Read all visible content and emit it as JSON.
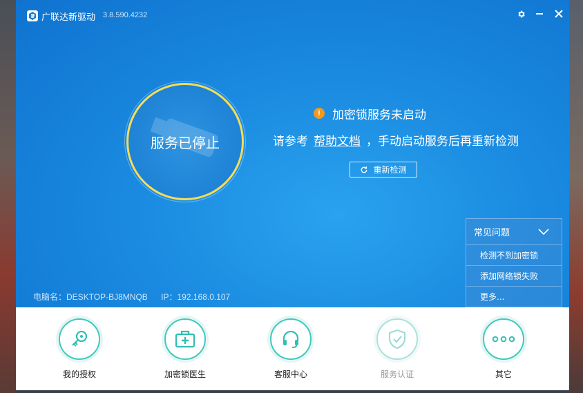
{
  "window": {
    "app_name": "广联达新驱动",
    "version": "3.8.590.4232"
  },
  "titlebar_buttons": [
    "gear-icon",
    "minimize-icon",
    "close-icon"
  ],
  "status": {
    "circle_text": "服务已停止",
    "alert_text": "加密锁服务未启动",
    "hint_prefix": "请参考",
    "hint_link": "帮助文档",
    "hint_suffix": "，手动启动服务后再重新检测",
    "recheck_label": "重新检测"
  },
  "machine": {
    "pc_name": "电脑名：DESKTOP-BJ8MNQB",
    "ip": "IP：192.168.0.107"
  },
  "faq": {
    "title": "常见问题",
    "items": [
      "检测不到加密锁",
      "添加网络锁失败",
      "更多..."
    ]
  },
  "bottom_nav": [
    {
      "label": "我的授权",
      "icon": "key-icon",
      "enabled": true
    },
    {
      "label": "加密锁医生",
      "icon": "medical-kit-icon",
      "enabled": true
    },
    {
      "label": "客服中心",
      "icon": "headset-icon",
      "enabled": true
    },
    {
      "label": "服务认证",
      "icon": "shield-check-icon",
      "enabled": false
    },
    {
      "label": "其它",
      "icon": "more-icon",
      "enabled": true
    }
  ],
  "colors": {
    "accent_blue": "#1a8ae0",
    "ring_yellow": "#f5dd59",
    "alert_orange": "#f39a1e",
    "teal": "#3ec9bd"
  }
}
